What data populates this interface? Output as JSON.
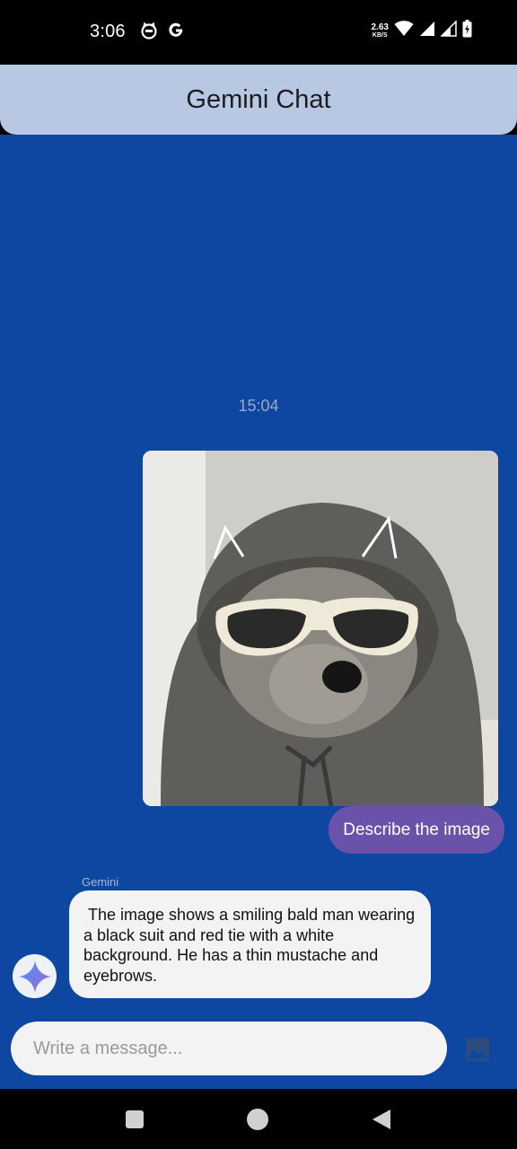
{
  "status_bar": {
    "time": "3:06",
    "left_icons": [
      "cat-notification-icon",
      "google-icon"
    ],
    "net_speed_value": "2.63",
    "net_speed_unit": "KB/S",
    "right_icons": [
      "wifi-icon",
      "signal-icon",
      "signal-icon",
      "battery-charging-icon"
    ]
  },
  "app_bar": {
    "title": "Gemini Chat"
  },
  "chat": {
    "timestamp": "15:04",
    "user_message": {
      "image_icon": "teddy-bear-photo",
      "text": "Describe the image"
    },
    "bot_message": {
      "sender": "Gemini",
      "avatar_icon": "gemini-sparkle-icon",
      "text": " The image shows a smiling bald man wearing a black suit and red tie with a white background. He has a thin mustache and eyebrows."
    }
  },
  "composer": {
    "placeholder": "Write a message...",
    "value": "",
    "image_button_icon": "image-icon"
  },
  "nav_bar": {
    "buttons": [
      "recents-square-icon",
      "home-circle-icon",
      "back-triangle-icon"
    ]
  },
  "colors": {
    "chat_background": "#0e47a1",
    "app_bar": "#b8c8e2",
    "user_bubble": "#6a52ab",
    "bot_bubble": "#f3f3f3"
  }
}
